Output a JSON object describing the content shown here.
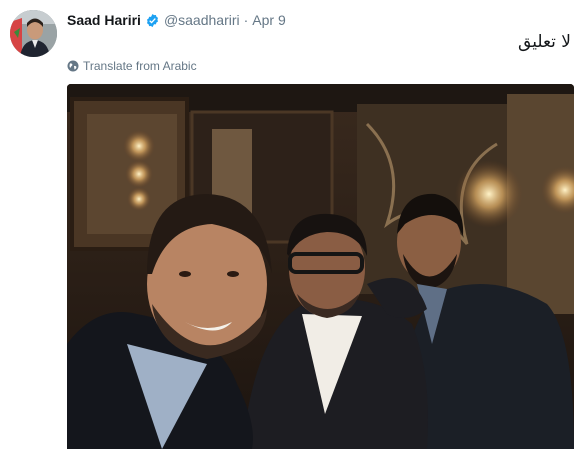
{
  "tweet": {
    "author_name": "Saad Hariri",
    "handle": "@saadhariri",
    "separator": "·",
    "date": "Apr 9",
    "text": "لا تعليق",
    "translate_label": "Translate from Arabic",
    "verified": true
  },
  "icons": {
    "verified": "verified-badge-icon",
    "translate": "globe-icon"
  },
  "colors": {
    "secondary_text": "#657786",
    "verified_blue": "#1da1f2"
  }
}
